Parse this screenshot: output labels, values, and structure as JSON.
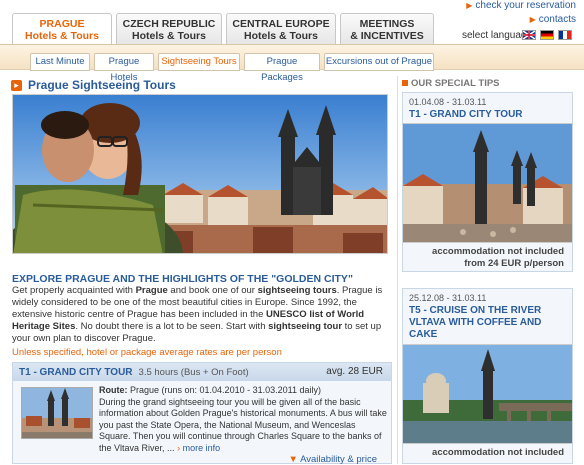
{
  "header": {
    "tabs": [
      {
        "line1": "PRAGUE",
        "line2": "Hotels & Tours"
      },
      {
        "line1": "CZECH REPUBLIC",
        "line2": "Hotels & Tours"
      },
      {
        "line1": "CENTRAL EUROPE",
        "line2": "Hotels & Tours"
      },
      {
        "line1": "MEETINGS",
        "line2": "& INCENTIVES"
      }
    ],
    "check_reservation": "check your reservation",
    "contacts": "contacts",
    "select_language": "select language",
    "flags": [
      "flag-uk-icon",
      "flag-germany-icon",
      "flag-france-icon"
    ]
  },
  "subnav": [
    "Last Minute",
    "Prague Hotels",
    "Sightseeing Tours",
    "Prague Packages",
    "Excursions out of Prague"
  ],
  "main": {
    "title": "Prague Sightseeing Tours",
    "intro_title": "EXPLORE PRAGUE AND THE HIGHLIGHTS OF THE \"GOLDEN CITY\"",
    "intro": {
      "p1": "Get properly acquainted with ",
      "b1": "Prague",
      "p2": " and book one of our ",
      "b2": "sightseeing tours",
      "p3": ". Prague is widely considered to be one of the most beautiful cities in Europe. Since 1992, the extensive historic centre of Prague has been included in the ",
      "b3": "UNESCO list of World Heritage Sites",
      "p4": ". No doubt there is a lot to be seen. Start with ",
      "b4": "sightseeing tour",
      "p5": " to set up your own plan to discover Prague."
    },
    "note": "Unless specified, hotel or package average rates are per person",
    "tour": {
      "name": "T1 - GRAND CITY TOUR",
      "duration": "3.5 hours (Bus + On Foot)",
      "price": "avg. 28 EUR",
      "route_label": "Route:",
      "route": " Prague (runs on: 01.04.2010 - 31.03.2011 daily)",
      "description": "During the grand sightseeing tour you will be given all of the basic information about Golden Prague's historical monuments. A bus will take you past the State Opera, the National Museum, and Wenceslas Square. Then you will continue through Charles Square to the banks of the Vltava River, ...",
      "more_info": "more info",
      "availability": "Availability & price"
    }
  },
  "tips": {
    "heading": "OUR SPECIAL TIPS",
    "items": [
      {
        "dates": "01.04.08 - 31.03.11",
        "title": "T1 - GRAND CITY TOUR",
        "accommodation": "accommodation not included",
        "from": "from 24 EUR p/person"
      },
      {
        "dates": "25.12.08 - 31.03.11",
        "title": "T5 - CRUISE ON THE RIVER VLTAVA WITH COFFEE AND CAKE",
        "accommodation": "accommodation not included",
        "from": ""
      }
    ]
  },
  "colors": {
    "accent": "#e8640a",
    "link": "#2a5c9a"
  }
}
